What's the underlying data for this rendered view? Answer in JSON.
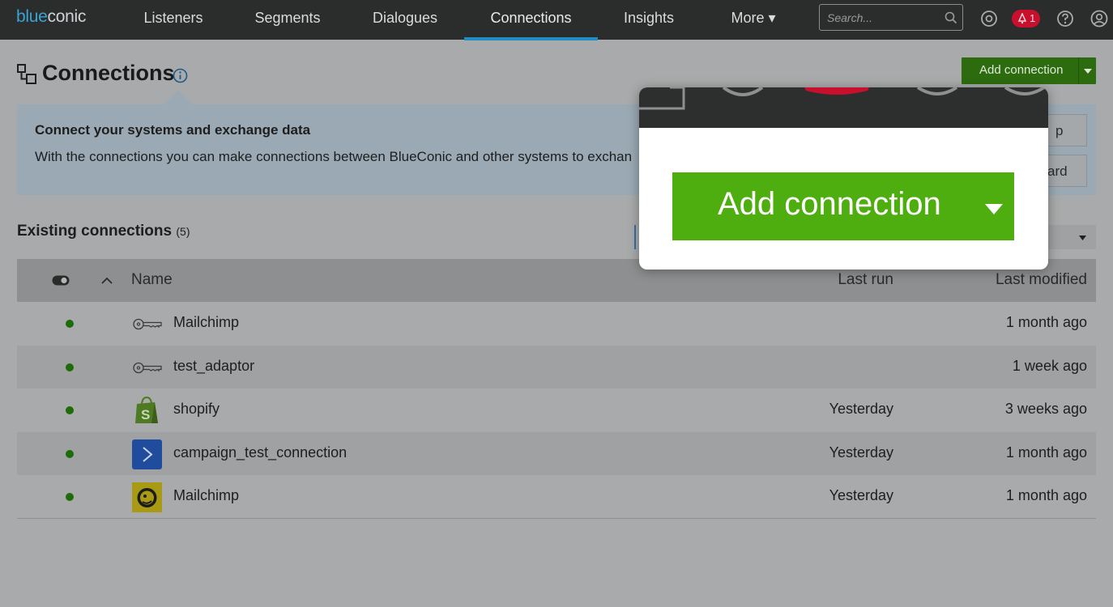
{
  "nav": {
    "logo_blue": "blue",
    "logo_grey": "conic",
    "items": [
      {
        "label": "Listeners"
      },
      {
        "label": "Segments"
      },
      {
        "label": "Dialogues"
      },
      {
        "label": "Connections"
      },
      {
        "label": "Insights"
      },
      {
        "label": "More ▾"
      }
    ],
    "active_item": "Connections",
    "search_placeholder": "Search...",
    "notification_count": "1"
  },
  "page": {
    "title": "Connections",
    "add_button_label": "Add connection",
    "info_title": "Connect your systems and exchange data",
    "info_text": "With the connections you can make connections between BlueConic and other systems to exchan",
    "side_button_1": "p",
    "side_button_2": "ard",
    "section_title": "Existing connections",
    "section_count": "(5)"
  },
  "table": {
    "columns": {
      "name": "Name",
      "last_run": "Last run",
      "last_modified": "Last modified"
    },
    "rows": [
      {
        "name": "Mailchimp",
        "icon": "key-icon",
        "last_run": "",
        "last_modified": "1 month ago"
      },
      {
        "name": "test_adaptor",
        "icon": "key-icon",
        "last_run": "",
        "last_modified": "1 week ago"
      },
      {
        "name": "shopify",
        "icon": "shopify-icon",
        "last_run": "Yesterday",
        "last_modified": "3 weeks ago"
      },
      {
        "name": "campaign_test_connection",
        "icon": "activecampaign-icon",
        "last_run": "Yesterday",
        "last_modified": "1 month ago"
      },
      {
        "name": "Mailchimp",
        "icon": "mailchimp-icon",
        "last_run": "Yesterday",
        "last_modified": "1 month ago"
      }
    ]
  },
  "popup": {
    "button_label": "Add connection"
  },
  "colors": {
    "topbar": "#2b2c2c",
    "accent_blue": "#1d8fc4",
    "add_button_green": "#4fae0f",
    "status_active": "#1e6c08",
    "notification_red": "#c8102e"
  }
}
